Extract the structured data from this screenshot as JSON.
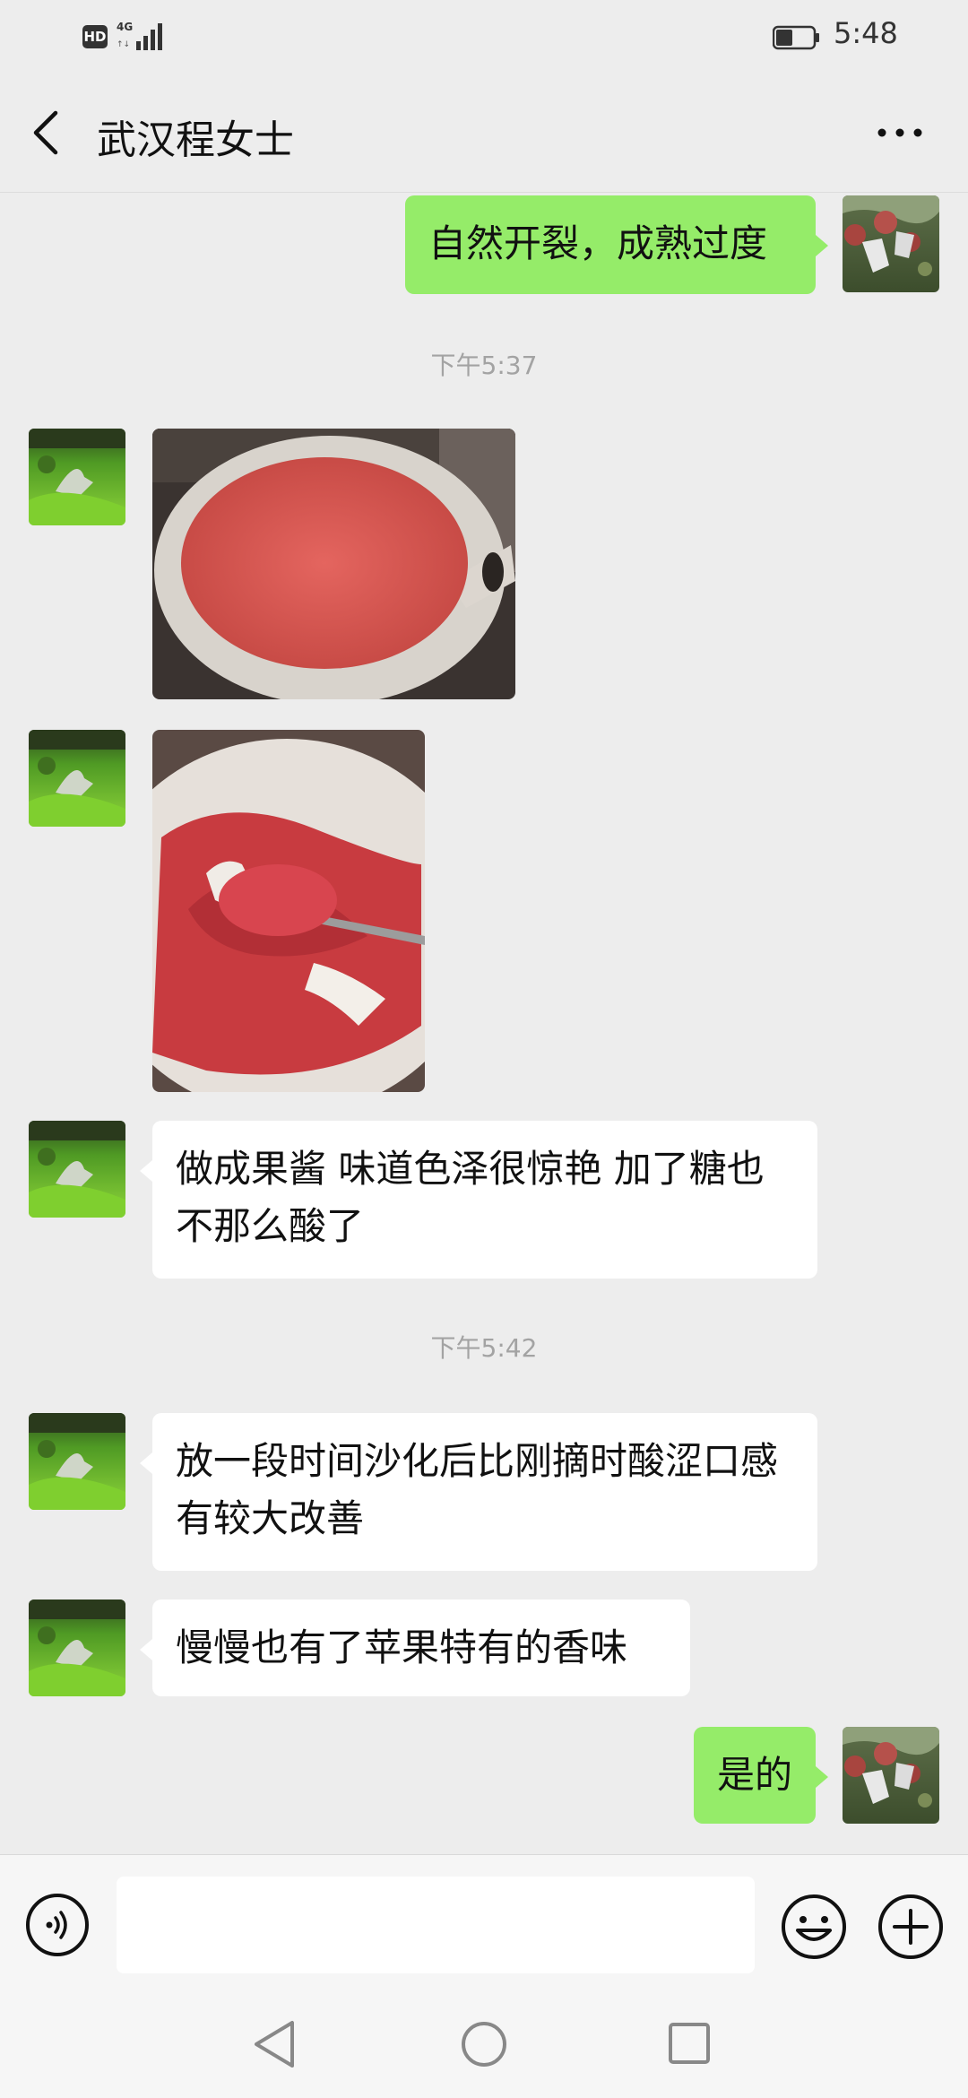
{
  "status_bar": {
    "hd_label": "HD",
    "network_label": "4G",
    "time": "5:48"
  },
  "header": {
    "title": "武汉程女士"
  },
  "messages": [
    {
      "type": "text",
      "direction": "out",
      "text": "自然开裂，成熟过度"
    },
    {
      "type": "timestamp",
      "text": "下午5:37"
    },
    {
      "type": "image",
      "direction": "in",
      "image": "jam-in-pan-photo"
    },
    {
      "type": "image",
      "direction": "in",
      "image": "jam-on-spoon-photo"
    },
    {
      "type": "text",
      "direction": "in",
      "text": "做成果酱 味道色泽很惊艳 加了糖也不那么酸了"
    },
    {
      "type": "timestamp",
      "text": "下午5:42"
    },
    {
      "type": "text",
      "direction": "in",
      "text": "放一段时间沙化后比刚摘时酸涩口感有较大改善"
    },
    {
      "type": "text",
      "direction": "in",
      "text": "慢慢也有了苹果特有的香味"
    },
    {
      "type": "text",
      "direction": "out",
      "text": "是的"
    }
  ],
  "input_bar": {
    "value": "",
    "placeholder": ""
  },
  "colors": {
    "background": "#ededed",
    "outgoing_bubble": "#95ec69",
    "incoming_bubble": "#ffffff",
    "timestamp_text": "#a3a3a3"
  },
  "icons": [
    "back-icon",
    "more-icon",
    "voice-icon",
    "emoji-icon",
    "plus-icon",
    "nav-back-icon",
    "nav-home-icon",
    "nav-recent-icon",
    "signal-icon",
    "battery-icon"
  ]
}
